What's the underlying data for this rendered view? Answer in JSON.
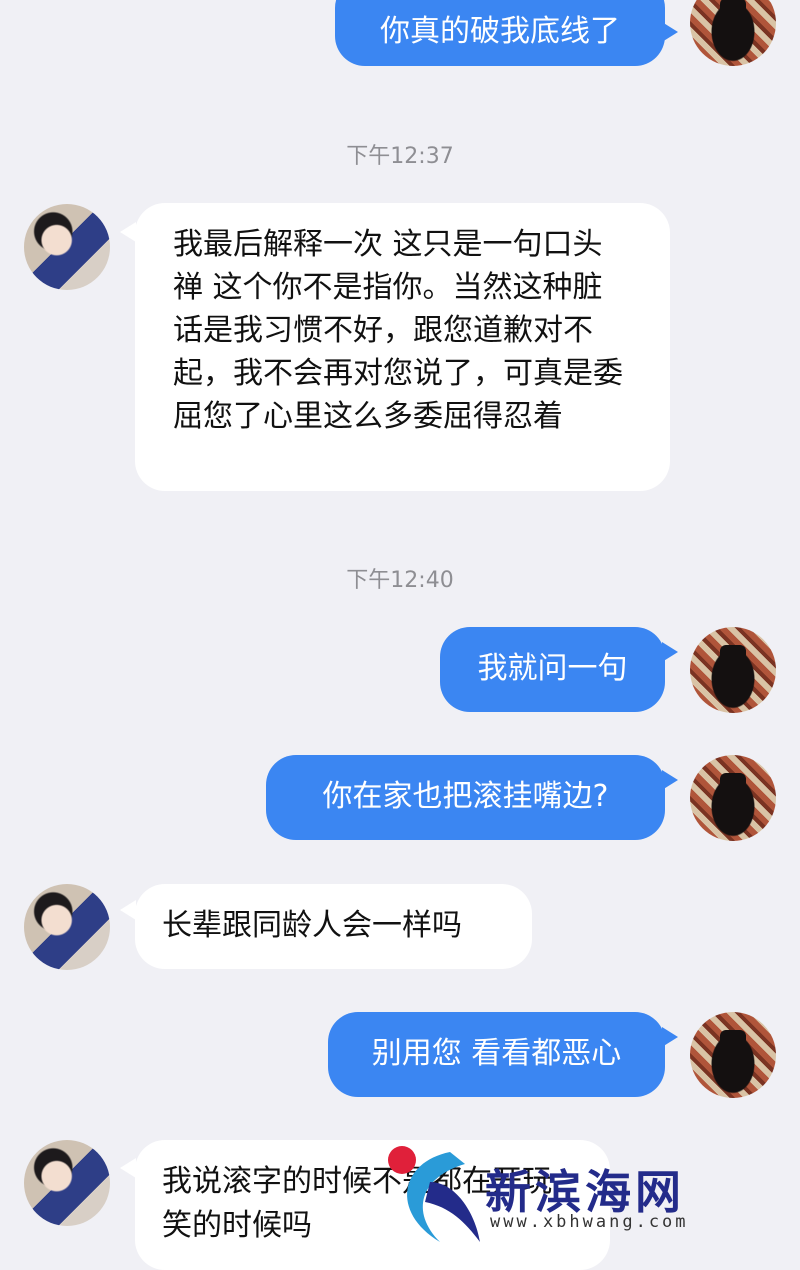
{
  "messages": [
    {
      "text": "你真的破我底线了"
    },
    {
      "timestamp": "下午12:37"
    },
    {
      "text": "我最后解释一次 这只是一句口头禅 这个你不是指你。当然这种脏话是我习惯不好，跟您道歉对不起，我不会再对您说了，可真是委屈您了心里这么多委屈得忍着"
    },
    {
      "timestamp": "下午12:40"
    },
    {
      "text": "我就问一句"
    },
    {
      "text": "你在家也把滚挂嘴边?"
    },
    {
      "text": "长辈跟同龄人会一样吗"
    },
    {
      "text": "别用您 看看都恶心"
    },
    {
      "text": "我说滚字的时候不是都在开玩笑的时候吗"
    }
  ],
  "watermark": {
    "brand": "新滨海网",
    "url": "www.xbhwang.com"
  },
  "colors": {
    "outgoing": "#3b86f2",
    "incoming": "#ffffff",
    "background": "#f0f0f5"
  }
}
